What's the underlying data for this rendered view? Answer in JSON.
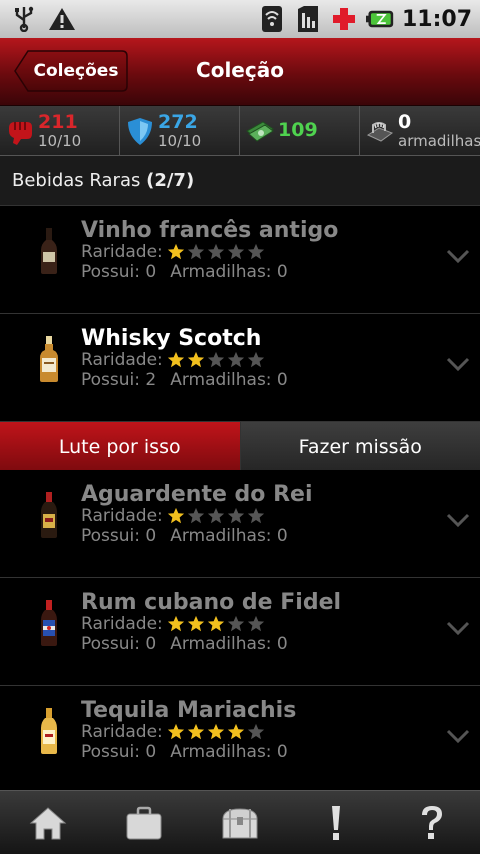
{
  "status_bar": {
    "time": "11:07",
    "left_icons": [
      "usb-icon",
      "warning-icon"
    ],
    "right_icons": [
      "wifi-icon",
      "sim-icon",
      "red-cross-icon",
      "battery-icon"
    ]
  },
  "header": {
    "back_label": "Coleções",
    "title": "Coleção"
  },
  "stats": [
    {
      "icon": "fist-icon",
      "value": "211",
      "sub": "10/10",
      "color": "#d9262b"
    },
    {
      "icon": "shield-icon",
      "value": "272",
      "sub": "10/10",
      "color": "#3aa6e6"
    },
    {
      "icon": "cash-icon",
      "value": "109",
      "sub": "",
      "color": "#4fd24f"
    },
    {
      "icon": "trap-icon",
      "value": "0",
      "sub": "armadilhas",
      "color": "#ffffff"
    }
  ],
  "section": {
    "label": "Bebidas Raras",
    "count": "(2/7)"
  },
  "items": [
    {
      "name": "Vinho francês antigo",
      "rarity_label": "Raridade:",
      "rarity": 1,
      "owned": "Possui: 0",
      "traps": "Armadilhas: 0",
      "owned_active": false
    },
    {
      "name": "Whisky Scotch",
      "rarity_label": "Raridade:",
      "rarity": 2,
      "owned": "Possui: 2",
      "traps": "Armadilhas: 0",
      "owned_active": true
    },
    {
      "name": "Aguardente do Rei",
      "rarity_label": "Raridade:",
      "rarity": 1,
      "owned": "Possui: 0",
      "traps": "Armadilhas: 0",
      "owned_active": false
    },
    {
      "name": "Rum cubano de Fidel",
      "rarity_label": "Raridade:",
      "rarity": 3,
      "owned": "Possui: 0",
      "traps": "Armadilhas: 0",
      "owned_active": false
    },
    {
      "name": "Tequila Mariachis",
      "rarity_label": "Raridade:",
      "rarity": 4,
      "owned": "Possui: 0",
      "traps": "Armadilhas: 0",
      "owned_active": false
    }
  ],
  "actions": {
    "fight_label": "Lute por isso",
    "mission_label": "Fazer missão"
  },
  "bottom_nav": [
    "home-icon",
    "briefcase-icon",
    "chest-icon",
    "exclamation-icon",
    "question-icon"
  ],
  "colors": {
    "accent_red": "#b5161c",
    "star_gold": "#f2c01e",
    "star_gray": "#555555"
  }
}
